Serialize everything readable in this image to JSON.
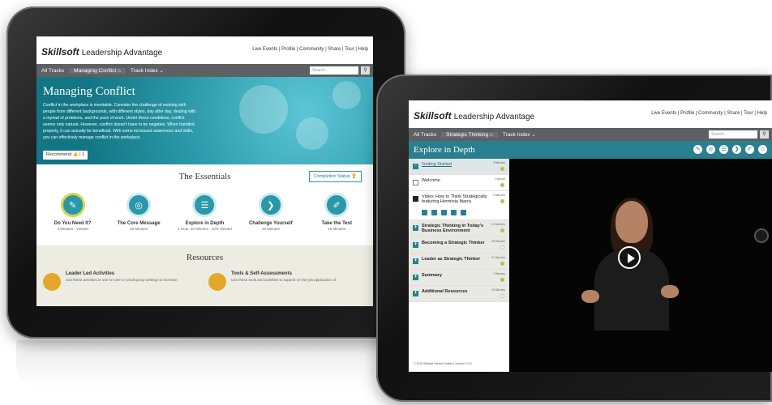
{
  "left_tablet": {
    "logo_brand": "Skillsoft",
    "logo_product": "Leadership Advantage",
    "top_links": "Live Events | Profile | Community | Share | Tour | Help",
    "nav": {
      "all_tracks": "All Tracks",
      "crumb": "Managing Conflict",
      "track_index": "Track Index ⌄",
      "search_placeholder": "Search..."
    },
    "hero": {
      "title": "Managing Conflict",
      "text": "Conflict in the workplace is inevitable. Consider the challenge of working with people from different backgrounds, with different styles, day after day, dealing with a myriad of problems, and the pace of work. Under these conditions, conflict seems only natural. However, conflict doesn't have to be negative. When handled properly, it can actually be beneficial. With some increased awareness and skills, you can effectively manage conflict in the workplace.",
      "recommend": "Recommend",
      "recommend_count": "1"
    },
    "essentials": {
      "title": "The Essentials",
      "completion": "Completion Status",
      "items": [
        {
          "title": "Do You Need It?",
          "sub": "5 Minutes - Viewed"
        },
        {
          "title": "The Core Message",
          "sub": "20 Minutes"
        },
        {
          "title": "Explore in Depth",
          "sub": "1 Hour, 45 Minutes - 10% Viewed"
        },
        {
          "title": "Challenge Yourself",
          "sub": "15 Minutes"
        },
        {
          "title": "Take the Test",
          "sub": "15 Minutes"
        }
      ]
    },
    "resources": {
      "title": "Resources",
      "items": [
        {
          "title": "Leader Led Activities",
          "sub": "Use these activities in one-on-one or small group settings to increase"
        },
        {
          "title": "Tools & Self-Assessments",
          "sub": "Use these tools and activities to support on-the-job application of"
        }
      ]
    }
  },
  "right_tablet": {
    "logo_brand": "Skillsoft",
    "logo_product": "Leadership Advantage",
    "top_links": "Live Events | Profile | Community | Share | Tour | Help",
    "nav": {
      "all_tracks": "All Tracks",
      "crumb": "Strategic Thinking",
      "track_index": "Track Index ⌄",
      "search_placeholder": "Search..."
    },
    "explore_title": "Explore in Depth",
    "items": [
      {
        "label": "Getting Started",
        "dur": "3 Minutes"
      },
      {
        "label": "Welcome",
        "dur": "1 Minute"
      },
      {
        "label": "Video: How to Think Strategically featuring Herminia Ibarra",
        "dur": "2 Minutes"
      },
      {
        "label": "Strategic Thinking in Today's Business Environment",
        "dur": "24 Minutes"
      },
      {
        "label": "Becoming a Strategic Thinker",
        "dur": "28 Minutes"
      },
      {
        "label": "Leader as Strategic Thinker",
        "dur": "21 Minutes"
      },
      {
        "label": "Summary",
        "dur": "2 Minutes"
      },
      {
        "label": "Additional Resources",
        "dur": "15 Minutes"
      }
    ],
    "copyright": "© 2016 Skillsoft Ireland Limited | Version 3.0.0"
  }
}
